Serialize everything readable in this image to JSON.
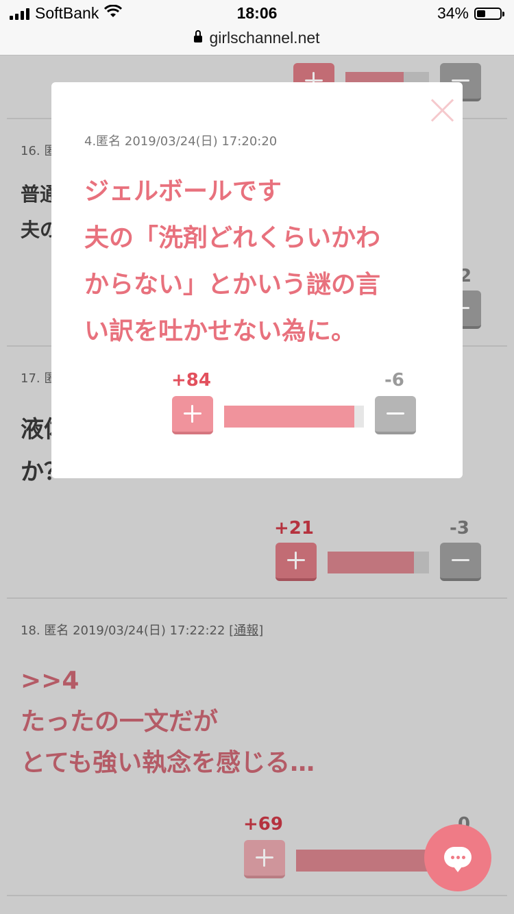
{
  "status": {
    "carrier": "SoftBank",
    "time": "18:06",
    "battery": "34%"
  },
  "browser": {
    "url": "girlschannel.net"
  },
  "background": {
    "comment_top": {
      "plus": "+",
      "minus": "−",
      "plus_ratio": 0.7
    },
    "comment16": {
      "meta_partial": "16. 匿",
      "text_line1": "普通",
      "text_line2": "夫の",
      "minus_partial": "2",
      "plus_ratio": 0.7
    },
    "comment17": {
      "meta_partial": "17. 匿",
      "text_line1": "液体",
      "text_line2": "か？",
      "plus": "+21",
      "minus": "-3",
      "plus_ratio": 0.85
    },
    "comment18": {
      "meta": "18. 匿名 2019/03/24(日) 17:22:22",
      "report": "[通報]",
      "line1": ">>4",
      "line2": "たったの一文だが",
      "line3": "とても強い執念を感じる…",
      "plus": "+69",
      "minus": "0",
      "plus_ratio": 1.0
    }
  },
  "modal": {
    "meta": "4.匿名 2019/03/24(日) 17:20:20",
    "lines": [
      "ジェルボールです",
      "夫の「洗剤どれくらいかわ",
      "からない」とかいう謎の言",
      "い訳を吐かせない為に。"
    ],
    "plus": "+84",
    "minus": "-6",
    "plus_ratio": 0.93
  },
  "colors": {
    "accent_pink": "#e8717d",
    "plus_red": "#e2505d",
    "overlay_gray": "#cbcbcb"
  }
}
